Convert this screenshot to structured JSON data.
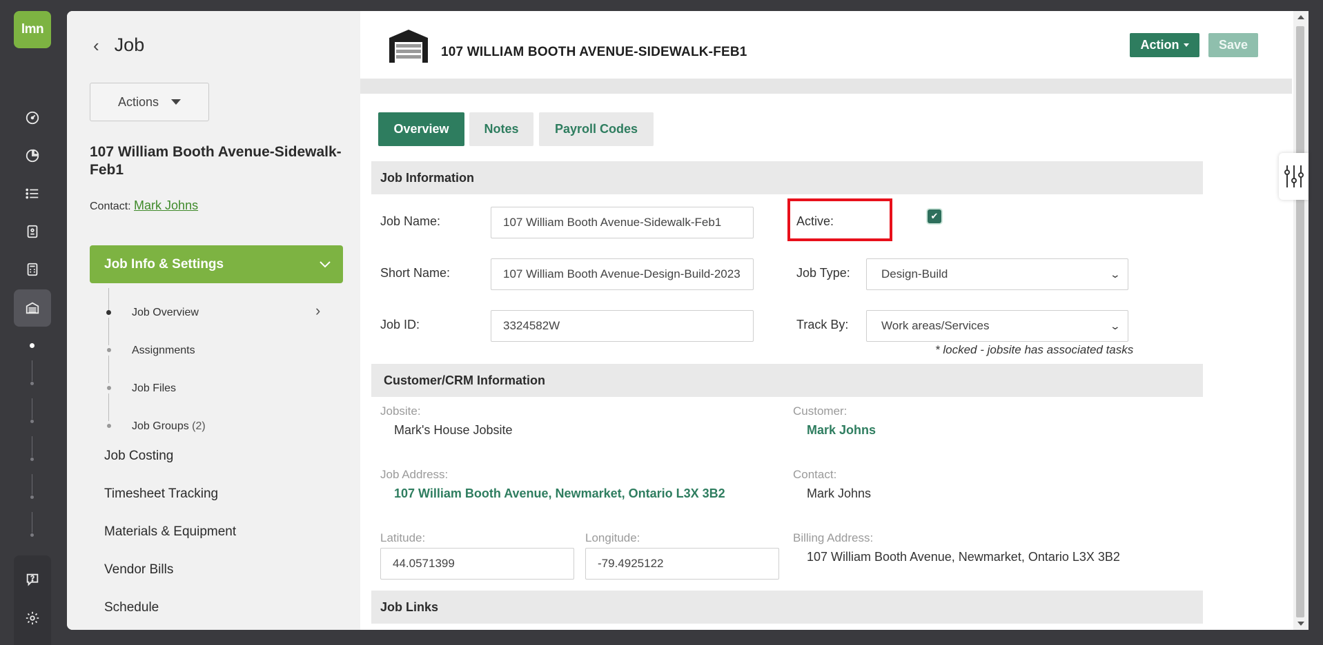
{
  "brand": {
    "logo_text": "lmn",
    "accent": "#7db342",
    "primary": "#2e7d5f"
  },
  "rail": {
    "icons": [
      "dashboard-icon",
      "pie-chart-icon",
      "list-icon",
      "timesheet-icon",
      "calculator-icon",
      "garage-icon"
    ],
    "bottom_icons": [
      "help-icon",
      "gear-icon"
    ]
  },
  "nav": {
    "title": "Job",
    "actions_label": "Actions",
    "job_heading": "107 William Booth Avenue-Sidewalk-Feb1",
    "contact_label": "Contact:",
    "contact_name": "Mark Johns",
    "active_section": "Job Info & Settings",
    "sub_items": [
      {
        "label": "Job Overview",
        "count": ""
      },
      {
        "label": "Assignments",
        "count": ""
      },
      {
        "label": "Job Files",
        "count": ""
      },
      {
        "label": "Job Groups",
        "count": "(2)"
      }
    ],
    "items": [
      "Job Costing",
      "Timesheet Tracking",
      "Materials & Equipment",
      "Vendor Bills",
      "Schedule"
    ]
  },
  "header": {
    "title": "107 WILLIAM BOOTH AVENUE-SIDEWALK-FEB1",
    "action_label": "Action",
    "save_label": "Save"
  },
  "tabs": [
    {
      "label": "Overview",
      "active": true
    },
    {
      "label": "Notes",
      "active": false
    },
    {
      "label": "Payroll Codes",
      "active": false
    }
  ],
  "job_info": {
    "section_title": "Job Information",
    "job_name_label": "Job Name:",
    "job_name_value": "107 William Booth Avenue-Sidewalk-Feb1",
    "active_label": "Active:",
    "active_checked": true,
    "short_name_label": "Short Name:",
    "short_name_value": "107 William Booth Avenue-Design-Build-2023",
    "job_type_label": "Job Type:",
    "job_type_value": "Design-Build",
    "job_id_label": "Job ID:",
    "job_id_value": "3324582W",
    "track_by_label": "Track By:",
    "track_by_value": "Work areas/Services",
    "locked_note": "* locked - jobsite has associated tasks"
  },
  "crm": {
    "section_title": "Customer/CRM Information",
    "jobsite_label": "Jobsite:",
    "jobsite_value": "Mark's House Jobsite",
    "customer_label": "Customer:",
    "customer_value": "Mark Johns",
    "job_address_label": "Job Address:",
    "job_address_value": "107 William Booth Avenue, Newmarket, Ontario L3X 3B2",
    "contact_label": "Contact:",
    "contact_value": "Mark Johns",
    "latitude_label": "Latitude:",
    "latitude_value": "44.0571399",
    "longitude_label": "Longitude:",
    "longitude_value": "-79.4925122",
    "billing_label": "Billing Address:",
    "billing_value": "107 William Booth Avenue, Newmarket, Ontario L3X 3B2"
  },
  "links": {
    "section_title": "Job Links"
  },
  "annotation": {
    "highlight_color": "#e8101b"
  }
}
